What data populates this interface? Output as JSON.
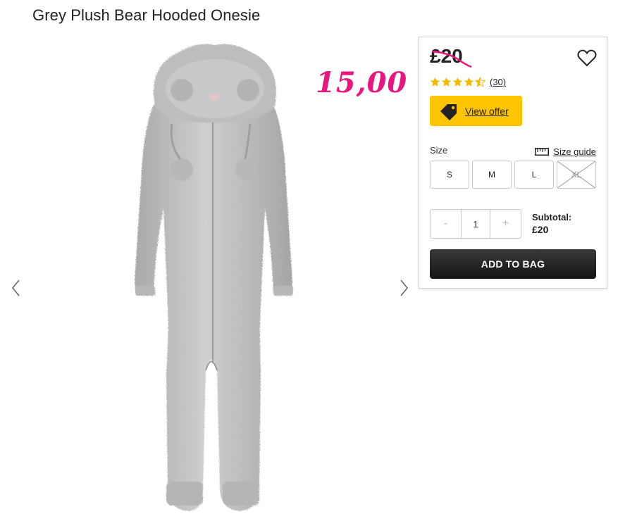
{
  "product": {
    "title": "Grey Plush Bear Hooded Onesie",
    "image_alt": "onesie-product-image"
  },
  "offer_overlay": {
    "price": "15,00",
    "color": "#e8167e"
  },
  "panel": {
    "price": "£20",
    "price_struck": true,
    "wishlist_icon": "heart-icon",
    "rating": {
      "value": 4.5,
      "max": 5,
      "count_label": "(30)",
      "star_color": "#f5b800"
    },
    "view_offer": {
      "label": "View offer",
      "icon": "tag-icon",
      "color": "#ffc400"
    },
    "size": {
      "label": "Size",
      "guide_label": "Size guide",
      "guide_icon": "ruler-icon",
      "options": [
        {
          "label": "S",
          "available": true
        },
        {
          "label": "M",
          "available": true
        },
        {
          "label": "L",
          "available": true
        },
        {
          "label": "XL",
          "available": false
        }
      ]
    },
    "quantity": {
      "minus": "-",
      "value": "1",
      "plus": "+"
    },
    "subtotal": {
      "label": "Subtotal:",
      "value": "£20"
    },
    "add_to_bag": "ADD TO BAG"
  },
  "gallery": {
    "prev_icon": "chevron-left-icon",
    "next_icon": "chevron-right-icon"
  }
}
